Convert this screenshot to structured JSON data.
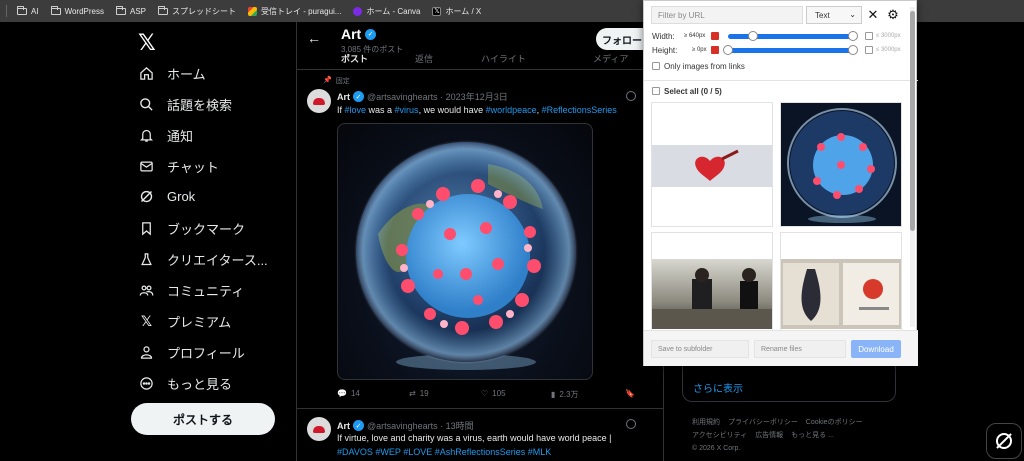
{
  "bookmarks": [
    {
      "label": "AI",
      "icon": "folder-icon"
    },
    {
      "label": "WordPress",
      "icon": "folder-icon"
    },
    {
      "label": "ASP",
      "icon": "folder-icon"
    },
    {
      "label": "スプレッドシート",
      "icon": "folder-icon"
    },
    {
      "label": "受信トレイ - puragui...",
      "icon": "gmail-icon"
    },
    {
      "label": "ホーム - Canva",
      "icon": "canva-icon"
    },
    {
      "label": "ホーム / X",
      "icon": "x-icon"
    }
  ],
  "nav": {
    "logo": "𝕏",
    "items": [
      {
        "label": "ホーム",
        "icon": "home-icon"
      },
      {
        "label": "話題を検索",
        "icon": "search-icon"
      },
      {
        "label": "通知",
        "icon": "bell-icon"
      },
      {
        "label": "チャット",
        "icon": "mail-icon"
      },
      {
        "label": "Grok",
        "icon": "grok-icon"
      },
      {
        "label": "ブックマーク",
        "icon": "bookmark-icon"
      },
      {
        "label": "クリエイタース...",
        "icon": "flask-icon"
      },
      {
        "label": "コミュニティ",
        "icon": "people-icon"
      },
      {
        "label": "プレミアム",
        "icon": "x-icon"
      },
      {
        "label": "プロフィール",
        "icon": "person-icon"
      },
      {
        "label": "もっと見る",
        "icon": "more-icon"
      }
    ],
    "post_button": "ポストする"
  },
  "profile": {
    "name": "Art",
    "post_count": "3,085 件のポスト",
    "follow_button": "フォロー",
    "tabs": [
      "ポスト",
      "返信",
      "ハイライト",
      "メディア"
    ]
  },
  "pinned_label": "固定",
  "tweet1": {
    "name": "Art",
    "handle": "@artsavinghearts · 2023年12月3日",
    "text_pre": "If ",
    "h1": "#love",
    "text_mid1": " was a ",
    "h2": "#virus",
    "text_mid2": ", we would have ",
    "h3": "#worldpeace",
    "text_mid3": ", ",
    "h4": "#ReflectionsSeries",
    "replies": "14",
    "reposts": "19",
    "likes": "105",
    "views": "2.3万"
  },
  "tweet2": {
    "name": "Art",
    "handle": "@artsavinghearts · 13時間",
    "line1": "If  virtue, love and charity was a virus, earth would have world peace |",
    "line2": "#DAVOS #WEP #LOVE #AshReflectionsSeries  #MLK"
  },
  "right": {
    "show_more": "さらに表示",
    "footer": [
      "利用規約",
      "プライバシーポリシー",
      "Cookieのポリシー",
      "アクセシビリティ",
      "広告情報",
      "もっと見る ...",
      "© 2026 X Corp."
    ]
  },
  "popup": {
    "filter_placeholder": "Filter by URL",
    "select_value": "Text",
    "width_label": "Width:",
    "width_min": "≥ 640px",
    "width_max": "≤ 3000px",
    "height_label": "Height:",
    "height_min": "≥ 0px",
    "height_max": "≤ 3000px",
    "only_links": "Only images from links",
    "select_all": "Select all (0 / 5)",
    "subfolder_placeholder": "Save to subfolder",
    "rename_placeholder": "Rename files",
    "download_label": "Download",
    "accent": "#1a73e8"
  }
}
